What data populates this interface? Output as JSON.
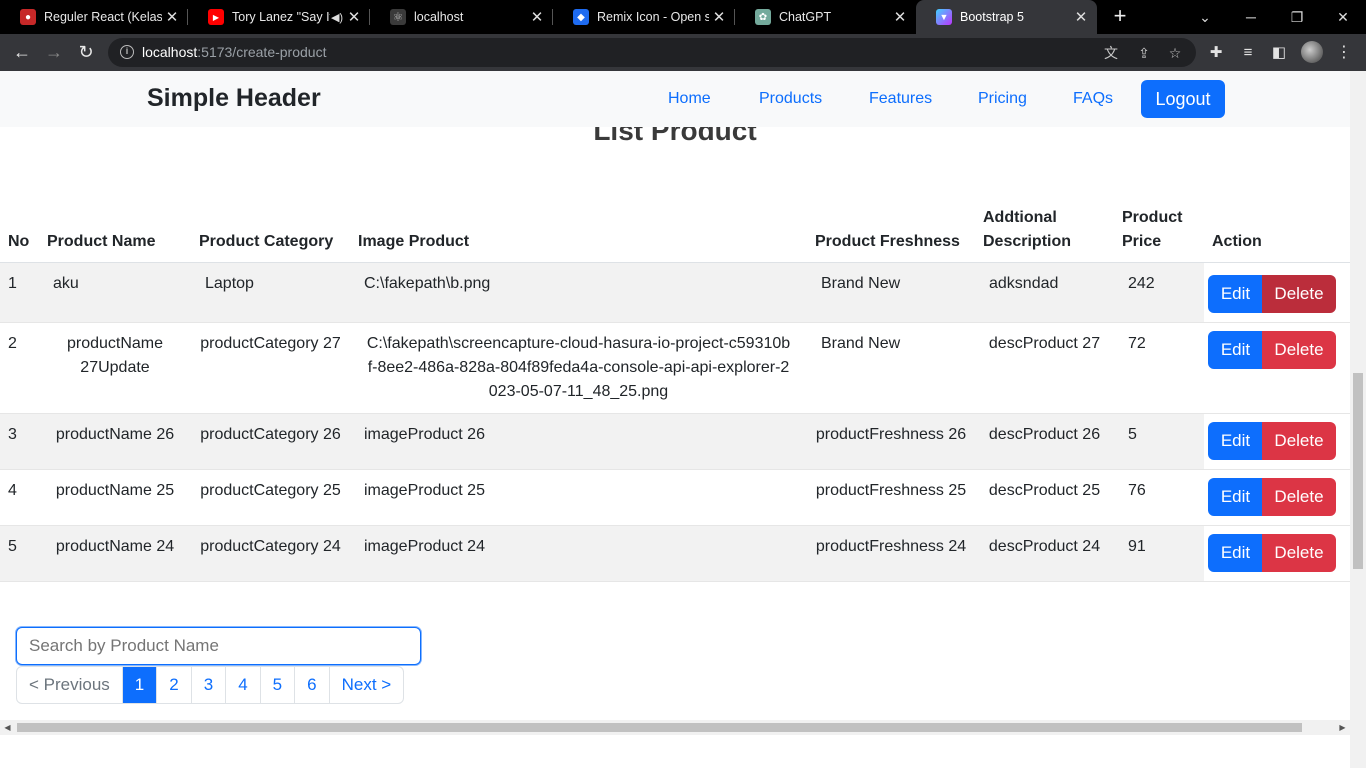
{
  "browser": {
    "tabs": [
      {
        "title": "Reguler React (Kelas A",
        "favicon_color": "#c62828",
        "favicon_glyph": "💧"
      },
      {
        "title": "Tory Lanez \"Say It\"",
        "favicon_color": "#ff0000",
        "favicon_glyph": "▶"
      },
      {
        "title": "localhost",
        "favicon_color": "#5a5a5a",
        "favicon_glyph": "⚛"
      },
      {
        "title": "Remix Icon - Open so",
        "favicon_color": "#1e6bf1",
        "favicon_glyph": "◆"
      },
      {
        "title": "ChatGPT",
        "favicon_color": "#74aa9c",
        "favicon_glyph": "✿"
      },
      {
        "title": "Bootstrap 5",
        "favicon_color": "#8c52ff",
        "favicon_glyph": "▼"
      }
    ],
    "address": {
      "host": "localhost",
      "path": ":5173/create-product"
    }
  },
  "header": {
    "brand": "Simple Header",
    "nav": [
      "Home",
      "Products",
      "Features",
      "Pricing",
      "FAQs"
    ],
    "logout_label": "Logout"
  },
  "page": {
    "title": "List Product",
    "search_placeholder": "Search by Product Name"
  },
  "table": {
    "columns": [
      "No",
      "Product Name",
      "Product Category",
      "Image Product",
      "Product Freshness",
      "Addtional Description",
      "Product Price",
      "Action"
    ],
    "rows": [
      {
        "no": "1",
        "name": "aku",
        "category": "Laptop",
        "image": "C:\\fakepath\\b.png",
        "freshness": "Brand New",
        "desc": "adksndad",
        "price": "242"
      },
      {
        "no": "2",
        "name": "productName 27Update",
        "category": "productCategory 27",
        "image": "C:\\fakepath\\screencapture-cloud-hasura-io-project-c59310bf-8ee2-486a-828a-804f89feda4a-console-api-api-explorer-2023-05-07-11_48_25.png",
        "freshness": "Brand New",
        "desc": "descProduct 27",
        "price": "72"
      },
      {
        "no": "3",
        "name": "productName 26",
        "category": "productCategory 26",
        "image": "imageProduct 26",
        "freshness": "productFreshness 26",
        "desc": "descProduct 26",
        "price": "5"
      },
      {
        "no": "4",
        "name": "productName 25",
        "category": "productCategory 25",
        "image": "imageProduct 25",
        "freshness": "productFreshness 25",
        "desc": "descProduct 25",
        "price": "76"
      },
      {
        "no": "5",
        "name": "productName 24",
        "category": "productCategory 24",
        "image": "imageProduct 24",
        "freshness": "productFreshness 24",
        "desc": "descProduct 24",
        "price": "91"
      }
    ],
    "edit_label": "Edit",
    "delete_label": "Delete"
  },
  "pagination": {
    "prev_label": "< Previous",
    "pages": [
      "1",
      "2",
      "3",
      "4",
      "5",
      "6"
    ],
    "next_label": "Next >",
    "current": "1"
  },
  "colors": {
    "primary": "#0d6efd",
    "danger": "#dc3545",
    "header_bg": "#f8f9fa",
    "stripe": "#f2f2f2"
  }
}
